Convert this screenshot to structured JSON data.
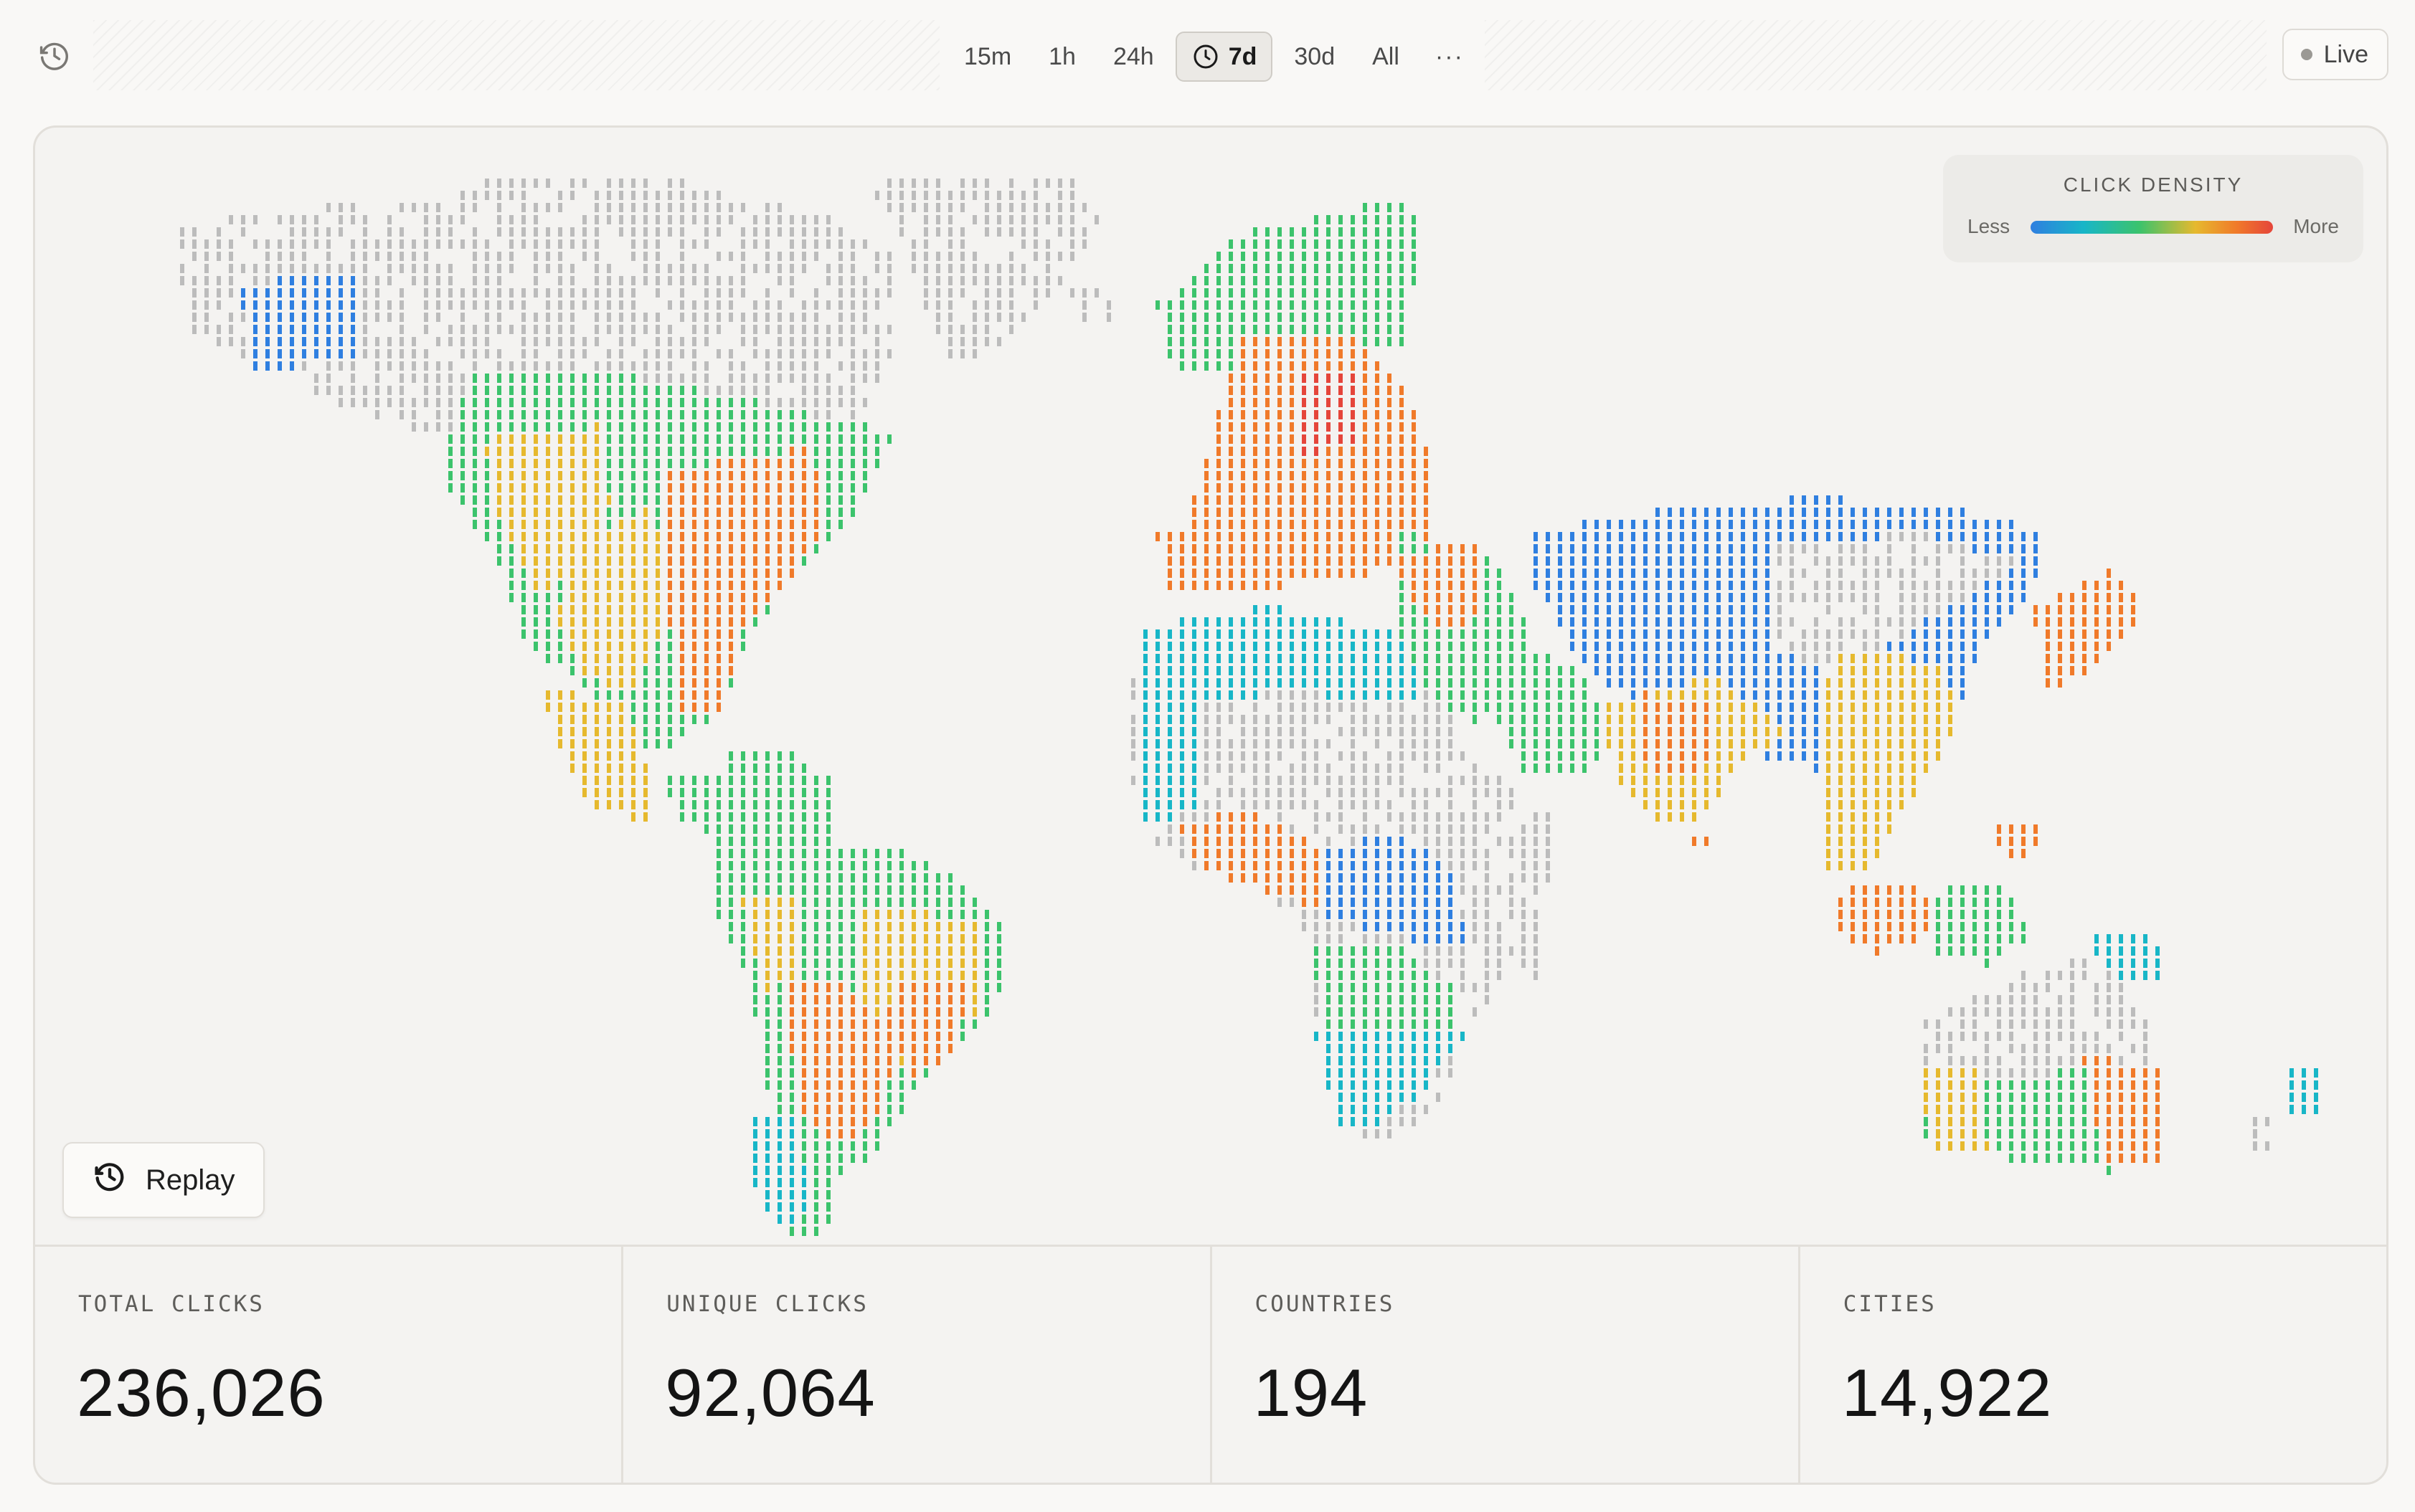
{
  "toolbar": {
    "history_icon": "clock-history-icon",
    "ranges": [
      {
        "label": "15m",
        "active": false
      },
      {
        "label": "1h",
        "active": false
      },
      {
        "label": "24h",
        "active": false
      },
      {
        "label": "7d",
        "active": true
      },
      {
        "label": "30d",
        "active": false
      },
      {
        "label": "All",
        "active": false
      }
    ],
    "more_label": "···",
    "live_label": "Live"
  },
  "map": {
    "legend": {
      "title": "CLICK DENSITY",
      "less": "Less",
      "more": "More"
    },
    "colors": {
      "none": "#bcbcbc",
      "low": "#2f7fe0",
      "low_mid": "#18b6c7",
      "mid": "#3cc36c",
      "mid_high": "#e6b92e",
      "high": "#f07a2a",
      "peak": "#e5453a"
    },
    "replay_label": "Replay"
  },
  "stats": [
    {
      "label": "TOTAL CLICKS",
      "value": "236,026"
    },
    {
      "label": "UNIQUE CLICKS",
      "value": "92,064"
    },
    {
      "label": "COUNTRIES",
      "value": "194"
    },
    {
      "label": "CITIES",
      "value": "14,922"
    }
  ]
}
